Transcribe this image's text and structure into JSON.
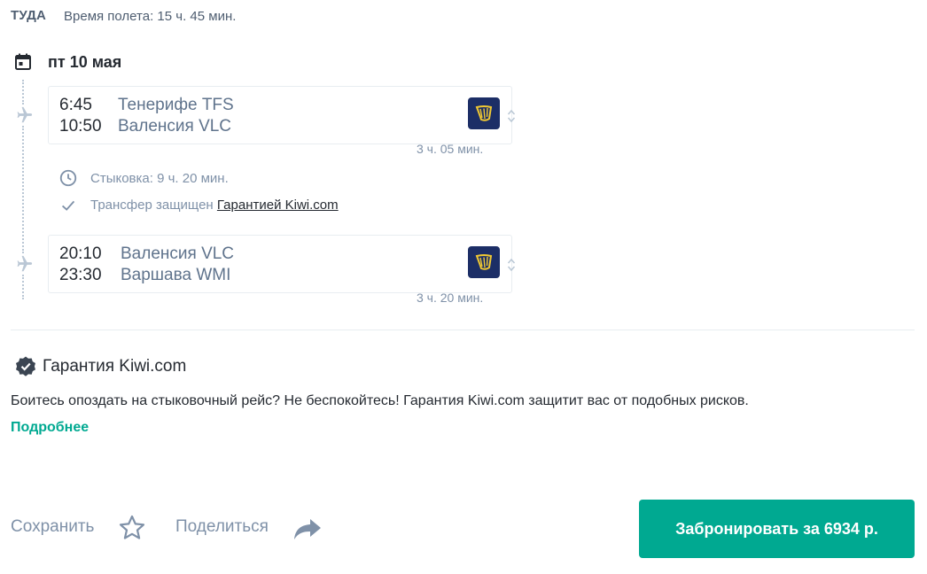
{
  "header": {
    "direction": "ТУДА",
    "duration": "Время полета: 15 ч. 45 мин."
  },
  "date": "пт 10 мая",
  "segments": [
    {
      "dep_time": "6:45",
      "dep_place": "Тенерифе TFS",
      "arr_time": "10:50",
      "arr_place": "Валенсия VLC",
      "duration": "3 ч. 05 мин.",
      "airline_logo": "ryanair-harp-logo"
    },
    {
      "dep_time": "20:10",
      "dep_place": "Валенсия VLC",
      "arr_time": "23:30",
      "arr_place": "Варшава WMI",
      "duration": "3 ч. 20 мин.",
      "airline_logo": "ryanair-harp-logo"
    }
  ],
  "connection": {
    "layover": "Стыковка: 9 ч. 20 мин.",
    "transfer_text": "Трансфер защищен",
    "transfer_link": "Гарантией Kiwi.com"
  },
  "guarantee": {
    "title": "Гарантия Kiwi.com",
    "description": "Боитесь опоздать на стыковочный рейс? Не беспокойтесь! Гарантия Kiwi.com защитит вас от подобных рисков.",
    "more_link": "Подробнее"
  },
  "actions": {
    "save_label": "Сохранить",
    "share_label": "Поделиться",
    "book_label": "Забронировать за 6934 р."
  },
  "colors": {
    "accent": "#00a991",
    "text": "#252a31",
    "muted": "#7f91a8",
    "logo_bg": "#1c2e66",
    "logo_fg": "#f1c933"
  }
}
